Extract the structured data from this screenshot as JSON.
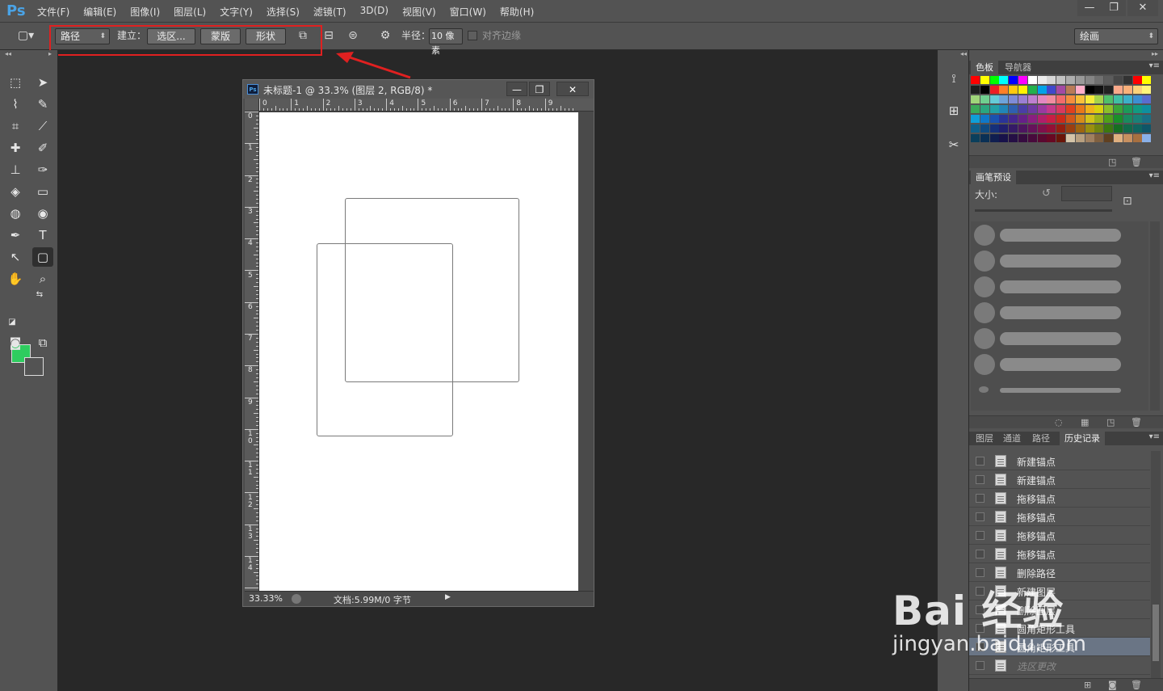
{
  "app": {
    "logo": "Ps",
    "menus": [
      "文件(F)",
      "编辑(E)",
      "图像(I)",
      "图层(L)",
      "文字(Y)",
      "选择(S)",
      "滤镜(T)",
      "3D(D)",
      "视图(V)",
      "窗口(W)",
      "帮助(H)"
    ],
    "window_controls": [
      "—",
      "❐",
      "✕"
    ]
  },
  "options": {
    "mode_select": "路径",
    "build_label": "建立：",
    "selection_btn": "选区...",
    "mask_btn": "蒙版",
    "shape_btn": "形状",
    "radius_label": "半径：",
    "radius_value": "10 像素",
    "align_edges_label": "对齐边缘",
    "workspace_select": "绘画"
  },
  "document": {
    "title": "未标题-1 @ 33.3% (图层 2, RGB/8) *",
    "ruler_h": [
      "0",
      "1",
      "2",
      "3",
      "4",
      "5",
      "6",
      "7",
      "8",
      "9"
    ],
    "ruler_v": [
      "0",
      "1",
      "2",
      "3",
      "4",
      "5",
      "6",
      "7",
      "8",
      "9",
      "1\n0",
      "1\n1",
      "1\n2",
      "1\n3",
      "1\n4"
    ],
    "zoom": "33.33%",
    "doc_info": "文档:5.99M/0 字节"
  },
  "colors": {
    "foreground": "#2ecc5f",
    "background": "#535353",
    "highlight": "#e02020"
  },
  "panels": {
    "swatch_tabs": [
      "色板",
      "导航器"
    ],
    "brush_tab": "画笔预设",
    "brush_size_label": "大小:",
    "layer_tabs": [
      "图层",
      "通道",
      "路径",
      "历史记录"
    ],
    "history": [
      {
        "label": "新建锚点",
        "active": false,
        "dim": false
      },
      {
        "label": "新建锚点",
        "active": false,
        "dim": false
      },
      {
        "label": "拖移锚点",
        "active": false,
        "dim": false
      },
      {
        "label": "拖移锚点",
        "active": false,
        "dim": false
      },
      {
        "label": "拖移锚点",
        "active": false,
        "dim": false
      },
      {
        "label": "拖移锚点",
        "active": false,
        "dim": false
      },
      {
        "label": "删除路径",
        "active": false,
        "dim": false
      },
      {
        "label": "新建图层",
        "active": false,
        "dim": false
      },
      {
        "label": "删除图层",
        "active": false,
        "dim": false
      },
      {
        "label": "圆角矩形工具",
        "active": false,
        "dim": false
      },
      {
        "label": "圆角矩形工具",
        "active": true,
        "dim": false
      },
      {
        "label": "选区更改",
        "active": false,
        "dim": true
      }
    ]
  },
  "watermark": {
    "brand": "Bai 经验",
    "url": "jingyan.baidu.com"
  }
}
